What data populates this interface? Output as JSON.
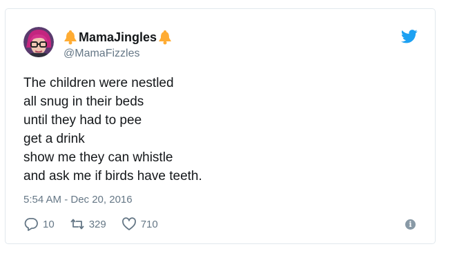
{
  "tweet": {
    "display_name": "MamaJingles",
    "handle": "@MamaFizzles",
    "text_lines": [
      "The children were nestled",
      "all snug in their beds",
      "until they had to pee",
      "get a drink",
      "show me they can whistle",
      "and ask me if birds have teeth."
    ],
    "timestamp": "5:54 AM - Dec 20, 2016",
    "replies": "10",
    "retweets": "329",
    "likes": "710"
  },
  "icons": {
    "brand": "twitter-bird-icon",
    "name_emoji": "bell-icon",
    "reply": "reply-icon",
    "retweet": "retweet-icon",
    "like": "heart-icon",
    "info": "info-icon"
  },
  "colors": {
    "twitter_blue": "#1da1f2",
    "bell": "#ffac33",
    "secondary_text": "#657786",
    "primary_text": "#14171a",
    "border": "#e1e8ed"
  }
}
